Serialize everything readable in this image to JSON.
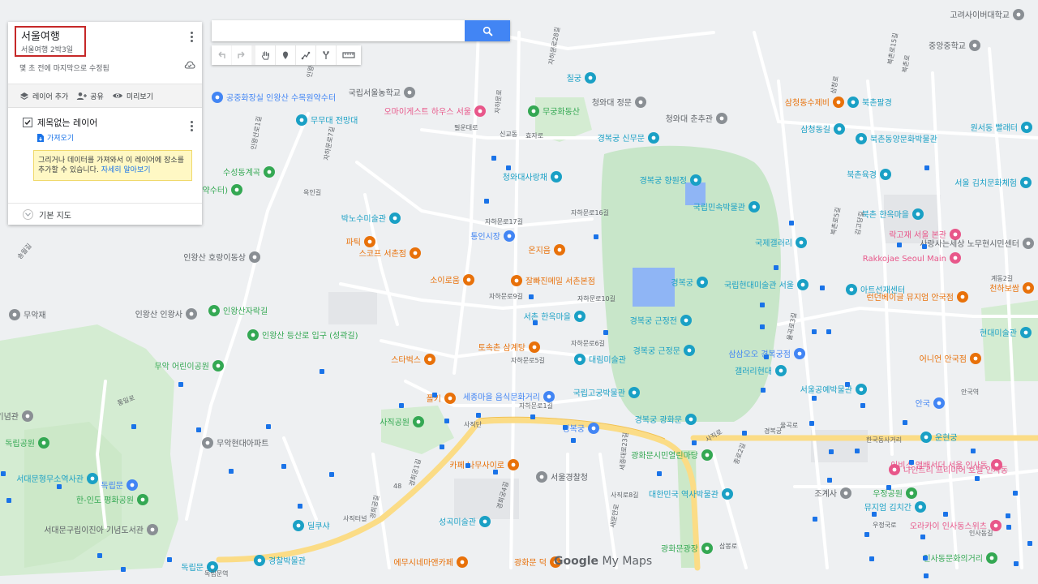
{
  "panel": {
    "map_title": "서울여행",
    "map_description": "서울여행 2박3일",
    "saved_status": "몇 초 전에 마지막으로 수정됨",
    "actions": {
      "add_layer": "레이어 추가",
      "share": "공유",
      "preview": "미리보기"
    },
    "layer": {
      "name": "제목없는 레이어",
      "import_label": "가져오기",
      "tooltip_text": "그리거나 데이터를 가져와서 이 레이어에 장소를 추가할 수 있습니다.",
      "tooltip_link": "자세히 알아보기"
    },
    "base_map_label": "기본 지도"
  },
  "search": {
    "value": "",
    "placeholder": ""
  },
  "attribution": {
    "google": "Google",
    "product": "My Maps"
  },
  "map": {
    "colors": {
      "green": "#34a853",
      "orange": "#e8710a",
      "blue": "#4285f4",
      "teal": "#1aa0c5",
      "pink": "#e8578a",
      "gray": "#8a8f94"
    },
    "pois": [
      {
        "label": "공중화장실 인왕산 수목원약수터",
        "color": "blue",
        "icon": "info"
      },
      {
        "label": "무무대 전망대",
        "color": "teal",
        "icon": "camera"
      },
      {
        "label": "국립서울농학교",
        "color": "gray",
        "icon": "school"
      },
      {
        "label": "오마이게스트 하우스 서울",
        "color": "pink",
        "icon": "bed"
      },
      {
        "label": "무궁화동산",
        "color": "green",
        "icon": "tree"
      },
      {
        "label": "칠궁",
        "color": "teal",
        "icon": "camera"
      },
      {
        "label": "청와대 정문",
        "color": "gray",
        "icon": "landmark"
      },
      {
        "label": "청와대 춘추관",
        "color": "gray",
        "icon": "landmark"
      },
      {
        "label": "경복궁 신무문",
        "color": "teal",
        "icon": "camera"
      },
      {
        "label": "청와대사랑채",
        "color": "teal",
        "icon": "camera"
      },
      {
        "label": "경복궁 향원정",
        "color": "teal",
        "icon": "camera"
      },
      {
        "label": "국립민속박물관",
        "color": "teal",
        "icon": "museum"
      },
      {
        "label": "국제갤러리",
        "color": "teal",
        "icon": "camera"
      },
      {
        "label": "경복궁",
        "color": "teal",
        "icon": "camera"
      },
      {
        "label": "국립현대미술관 서울",
        "color": "teal",
        "icon": "museum"
      },
      {
        "label": "경복궁 근정전",
        "color": "teal",
        "icon": "camera"
      },
      {
        "label": "경복궁 근정문",
        "color": "teal",
        "icon": "camera"
      },
      {
        "label": "경복궁 광화문",
        "color": "teal",
        "icon": "camera"
      },
      {
        "label": "국립고궁박물관",
        "color": "teal",
        "icon": "museum"
      },
      {
        "label": "광화문시민열린마당",
        "color": "green",
        "icon": "tree"
      },
      {
        "label": "대한민국 역사박물관",
        "color": "teal",
        "icon": "museum"
      },
      {
        "label": "광화문광장",
        "color": "green",
        "icon": "tree"
      },
      {
        "label": "수성동계곡",
        "color": "green",
        "icon": "tree"
      },
      {
        "label": "인왕산 입구 (인왕천 약수터)",
        "color": "green",
        "icon": "hike"
      },
      {
        "label": "박노수미술관",
        "color": "teal",
        "icon": "museum"
      },
      {
        "label": "인왕산 호랑이동상",
        "color": "gray",
        "icon": "pin"
      },
      {
        "label": "인왕산 인왕사",
        "color": "gray",
        "icon": "temple"
      },
      {
        "label": "인왕산자락길",
        "color": "green",
        "icon": "hike"
      },
      {
        "label": "인왕산 등산로 입구 (성곽길)",
        "color": "green",
        "icon": "hike"
      },
      {
        "label": "무악재",
        "color": "gray",
        "icon": "pin"
      },
      {
        "label": "무악 어린이공원",
        "color": "green",
        "icon": "tree"
      },
      {
        "label": "파틱",
        "color": "orange",
        "icon": "food"
      },
      {
        "label": "스코프 서촌점",
        "color": "orange",
        "icon": "cafe"
      },
      {
        "label": "소이로움",
        "color": "orange",
        "icon": "cafe"
      },
      {
        "label": "통인시장",
        "color": "blue",
        "icon": "shop"
      },
      {
        "label": "온지음",
        "color": "orange",
        "icon": "food"
      },
      {
        "label": "잘빠진메밀 서촌본점",
        "color": "orange",
        "icon": "food"
      },
      {
        "label": "서촌 한옥마을",
        "color": "teal",
        "icon": "camera"
      },
      {
        "label": "토속촌 삼계탕",
        "color": "orange",
        "icon": "food"
      },
      {
        "label": "스타벅스",
        "color": "orange",
        "icon": "cafe"
      },
      {
        "label": "대림미술관",
        "color": "teal",
        "icon": "museum"
      },
      {
        "label": "세종마을 음식문화거리",
        "color": "blue",
        "icon": "shop"
      },
      {
        "label": "폴키",
        "color": "orange",
        "icon": "cafe"
      },
      {
        "label": "사직공원",
        "color": "green",
        "icon": "tree"
      },
      {
        "label": "카페 나무사이로",
        "color": "orange",
        "icon": "cafe"
      },
      {
        "label": "서울경찰청",
        "color": "gray",
        "icon": "pin"
      },
      {
        "label": "성곡미술관",
        "color": "teal",
        "icon": "museum"
      },
      {
        "label": "딜쿠샤",
        "color": "teal",
        "icon": "camera"
      },
      {
        "label": "경찰박물관",
        "color": "teal",
        "icon": "museum"
      },
      {
        "label": "에무시네마앤카페",
        "color": "orange",
        "icon": "cafe"
      },
      {
        "label": "광화문 덕",
        "color": "orange",
        "icon": "food"
      },
      {
        "label": "독립문",
        "color": "teal",
        "icon": "camera"
      },
      {
        "label": "무악현대아파트",
        "color": "gray",
        "icon": "pin"
      },
      {
        "label": "서대문형무소역사관",
        "color": "teal",
        "icon": "museum"
      },
      {
        "label": "한-인도 평화공원",
        "color": "green",
        "icon": "tree"
      },
      {
        "label": "서대문구립이진아 기념도서관",
        "color": "gray",
        "icon": "pin"
      },
      {
        "label": "독립공원",
        "color": "green",
        "icon": "tree"
      },
      {
        "label": "한 대한민국 임시정부 기념관",
        "color": "gray",
        "icon": "pin"
      },
      {
        "label": "삼청동수제비",
        "color": "orange",
        "icon": "food"
      },
      {
        "label": "북촌팔경",
        "color": "teal",
        "icon": "camera"
      },
      {
        "label": "삼청동길",
        "color": "teal",
        "icon": "camera"
      },
      {
        "label": "북촌동양문화박물관",
        "color": "teal",
        "icon": "museum"
      },
      {
        "label": "북촌육경",
        "color": "teal",
        "icon": "camera"
      },
      {
        "label": "북촌 한옥마을",
        "color": "teal",
        "icon": "camera"
      },
      {
        "label": "락고재 서울 본관",
        "color": "pink",
        "icon": "bed"
      },
      {
        "label": "Rakkojae Seoul Main",
        "color": "pink",
        "icon": "bed"
      },
      {
        "label": "아트선재센터",
        "color": "teal",
        "icon": "museum"
      },
      {
        "label": "런던베이글 뮤지엄 안국점",
        "color": "orange",
        "icon": "food"
      },
      {
        "label": "현대미술관",
        "color": "teal",
        "icon": "museum"
      },
      {
        "label": "삼삼오오 경복궁점",
        "color": "blue",
        "icon": "shop"
      },
      {
        "label": "갤러리현대",
        "color": "teal",
        "icon": "camera"
      },
      {
        "label": "어니언 안국점",
        "color": "orange",
        "icon": "cafe"
      },
      {
        "label": "서울공예박물관",
        "color": "teal",
        "icon": "museum"
      },
      {
        "label": "안국",
        "color": "blue",
        "icon": "metro"
      },
      {
        "label": "운현궁",
        "color": "teal",
        "icon": "camera"
      },
      {
        "label": "우정공원",
        "color": "green",
        "icon": "tree"
      },
      {
        "label": "조계사",
        "color": "gray",
        "icon": "temple"
      },
      {
        "label": "나인트리 프리미어 호텔 인사동",
        "color": "pink",
        "icon": "bed"
      },
      {
        "label": "이비스 앰배서더 서울 인사동",
        "color": "pink",
        "icon": "bed"
      },
      {
        "label": "뮤지엄 김치간",
        "color": "teal",
        "icon": "museum"
      },
      {
        "label": "오라카이 인사동스위츠",
        "color": "pink",
        "icon": "bed"
      },
      {
        "label": "인사동문화의거리",
        "color": "green",
        "icon": "tree"
      },
      {
        "label": "중앙중학교",
        "color": "gray",
        "icon": "school"
      },
      {
        "label": "고려사이버대학교",
        "color": "gray",
        "icon": "school"
      },
      {
        "label": "서울 김치문화체험",
        "color": "teal",
        "icon": "museum"
      },
      {
        "label": "원서동 빨래터",
        "color": "teal",
        "icon": "camera"
      },
      {
        "label": "사랑사는세상 노무현시민센터",
        "color": "gray",
        "icon": "pin"
      },
      {
        "label": "천하보쌈",
        "color": "orange",
        "icon": "food"
      },
      {
        "label": "경복궁",
        "color": "blue",
        "icon": "metro"
      },
      {
        "label": "독립문",
        "color": "blue",
        "icon": "metro"
      }
    ],
    "streets": [
      "자하문로28길",
      "자하문로",
      "필운대로",
      "효자로",
      "자하문로17길",
      "자하문로16길",
      "자하문로9길",
      "자하문로10길",
      "자하문로6길",
      "자하문로5길",
      "자하문로1길",
      "인왕산로",
      "옥인길",
      "사직로",
      "율곡로",
      "삼청로",
      "북촌로",
      "계동2길",
      "북촌로5길",
      "세종대로23길",
      "사직로8길",
      "종로2길",
      "새문안로",
      "삼봉로",
      "통일로",
      "우정국로",
      "인사동길",
      "북촌로15길",
      "감고당길",
      "율곡로3길",
      "자하문로7길",
      "인왕산로1길",
      "송월길",
      "경희궁길",
      "경희궁1길",
      "경희궁4길",
      "사직단",
      "사직터널",
      "신교동",
      "독립문역",
      "경복궁",
      "안국역",
      "한국동사거리",
      "48"
    ]
  }
}
